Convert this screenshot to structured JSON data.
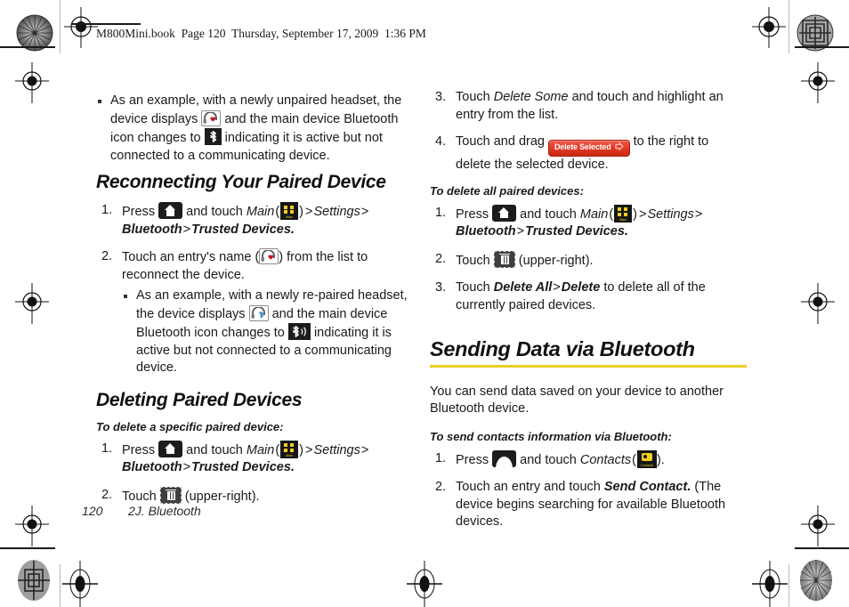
{
  "page": {
    "book_header": "M800Mini.book  Page 120  Thursday, September 17, 2009  1:36 PM",
    "footer_page_number": "120",
    "footer_chapter": "2J. Bluetooth"
  },
  "colors": {
    "accent_rule": "#e8d020",
    "main_icon_yellow": "#f3cf1b",
    "delete_button_red": "#e03a24",
    "heart_red": "#cc1122",
    "bluetooth_blue": "#2f86c5",
    "icon_black": "#1c1c1c"
  },
  "left_column": {
    "intro_bullet": {
      "text": "As an example, with a newly unpaired headset, the device displays",
      "mid": "and the main device Bluetooth icon changes to",
      "tail": "indicating it is active but not connected to a communicating device.",
      "icon_1": "headset-heart-icon",
      "icon_2": "bluetooth-icon"
    },
    "section_reconnect": {
      "heading": "Reconnecting Your Paired Device",
      "steps": [
        {
          "pre": "Press",
          "icon_home": "home-key-icon",
          "mid": "and touch",
          "menu_label": "Main",
          "icon_main": "main-menu-icon",
          "path": "Settings",
          "path2": "Bluetooth",
          "path3": "Trusted Devices."
        },
        {
          "pre": "Touch an entry's name (",
          "icon_headset": "headset-heart-icon",
          "post": ") from the list to reconnect the device."
        }
      ],
      "bullet": {
        "text": "As an example, with a newly re-paired headset, the device displays",
        "mid": "and the main device Bluetooth icon changes to",
        "tail": "indicating it is active but not connected to a communicating device.",
        "icon_1": "headset-bluetooth-icon",
        "icon_2": "bluetooth-active-icon"
      }
    },
    "section_deleting": {
      "heading": "Deleting Paired Devices",
      "lead": "To delete a specific paired device:",
      "steps": [
        {
          "pre": "Press",
          "icon_home": "home-key-icon",
          "mid": "and touch",
          "menu_label": "Main",
          "icon_main": "main-menu-icon",
          "path": "Settings",
          "path2": "Bluetooth",
          "path3": "Trusted Devices."
        },
        {
          "pre": "Touch",
          "icon_trash": "trash-icon",
          "post": "(upper-right)."
        }
      ]
    }
  },
  "right_column": {
    "continued_steps": [
      {
        "number": "3.",
        "pre": "Touch",
        "emphasis": "Delete Some",
        "post": "and touch and highlight an entry from the list."
      },
      {
        "number": "4.",
        "pre": "Touch and drag",
        "button_label": "Delete Selected",
        "post": "to the right to delete the selected device."
      }
    ],
    "delete_all": {
      "lead": "To delete all paired devices:",
      "steps": [
        {
          "pre": "Press",
          "icon_home": "home-key-icon",
          "mid": "and touch",
          "menu_label": "Main",
          "icon_main": "main-menu-icon",
          "path": "Settings",
          "path2": "Bluetooth",
          "path3": "Trusted Devices."
        },
        {
          "pre": "Touch",
          "icon_trash": "trash-icon",
          "post": "(upper-right)."
        },
        {
          "pre": "Touch",
          "emphasis": "Delete All",
          "emphasis2": "Delete",
          "post": "to delete all of the currently paired devices."
        }
      ]
    },
    "section_sending": {
      "heading": "Sending Data via Bluetooth",
      "paragraph": "You can send data saved on your device to another Bluetooth device.",
      "lead": "To send contacts information via Bluetooth:",
      "steps": [
        {
          "pre": "Press",
          "icon_send": "send-key-icon",
          "mid": "and touch",
          "app_label": "Contacts",
          "icon_contacts": "contacts-icon",
          "post": ")."
        },
        {
          "pre": "Touch an entry and touch",
          "emphasis": "Send Contact.",
          "post": "(The device begins searching for available Bluetooth devices."
        }
      ]
    }
  }
}
